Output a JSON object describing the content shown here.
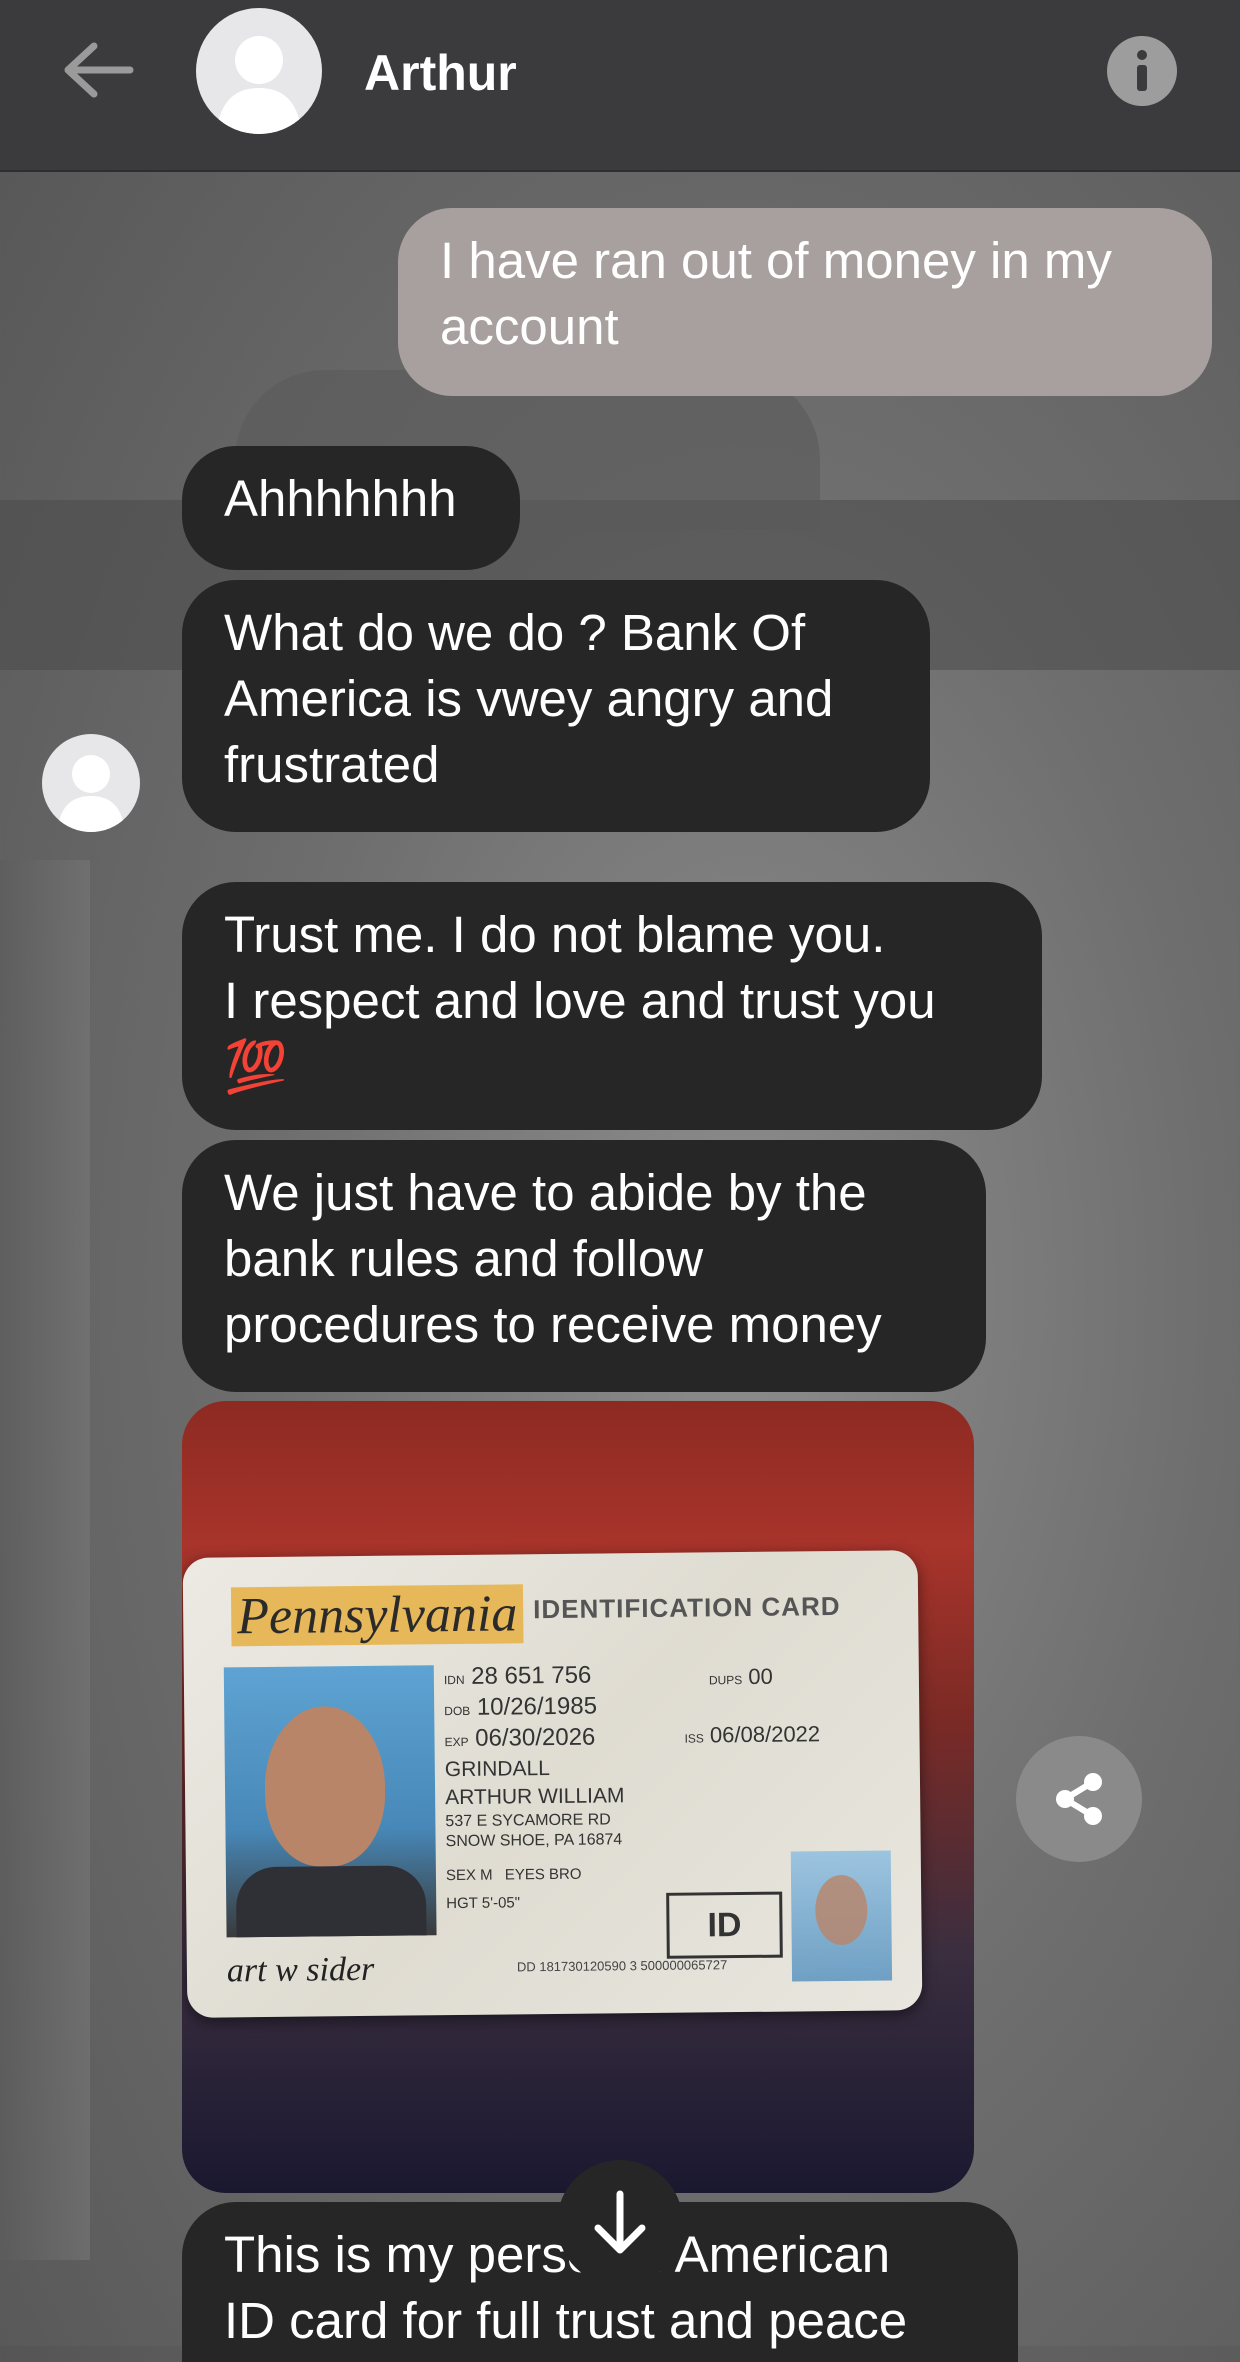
{
  "header": {
    "back_icon": "arrow-left-icon",
    "contact_name": "Arthur",
    "info_icon": "info-icon"
  },
  "messages": [
    {
      "direction": "outgoing",
      "lines": [
        "I have ran out of money in my",
        "account"
      ]
    },
    {
      "direction": "incoming",
      "lines": [
        "Ahhhhhhh"
      ]
    },
    {
      "direction": "incoming",
      "lines": [
        "What do we do ?   Bank Of",
        "America is vwey angry and",
        "frustrated"
      ]
    },
    {
      "direction": "incoming",
      "lines": [
        "Trust me.    I do not blame you.",
        "I respect and love and trust you",
        "💯"
      ]
    },
    {
      "direction": "incoming",
      "lines": [
        "We just have to abide by the",
        "bank rules and follow",
        "procedures to receive money"
      ]
    },
    {
      "direction": "incoming",
      "lines": [
        "This is my personal American",
        "ID card for full trust and peace"
      ]
    }
  ],
  "id_card": {
    "state": "Pennsylvania",
    "card_type": "IDENTIFICATION CARD",
    "id_number": "28 651 756",
    "dob": "10/26/1985",
    "exp": "06/30/2026",
    "dups": "00",
    "iss": "06/08/2022",
    "name_last": "GRINDALL",
    "name_first": "ARTHUR WILLIAM",
    "address1": "537 E SYCAMORE RD",
    "address2": "SNOW SHOE, PA 16874",
    "sex": "M",
    "eyes": "BRO",
    "height": "5'-05\"",
    "badge": "ID",
    "signature": "art w sider",
    "dd": "DD 181730120590 3 500000065727"
  },
  "labels": {
    "dob_label": "DOB",
    "exp_label": "EXP",
    "iss_label": "ISS",
    "dups_label": "DUPS",
    "sex_label": "SEX",
    "eyes_label": "EYES",
    "hgt_label": "HGT",
    "idn_label": "IDN"
  },
  "controls": {
    "share_icon": "share-icon",
    "scroll_icon": "arrow-down-icon"
  },
  "colors": {
    "topbar": "#3b3b3d",
    "incoming_bubble": "#262626",
    "outgoing_bubble": "#a8a09f"
  }
}
